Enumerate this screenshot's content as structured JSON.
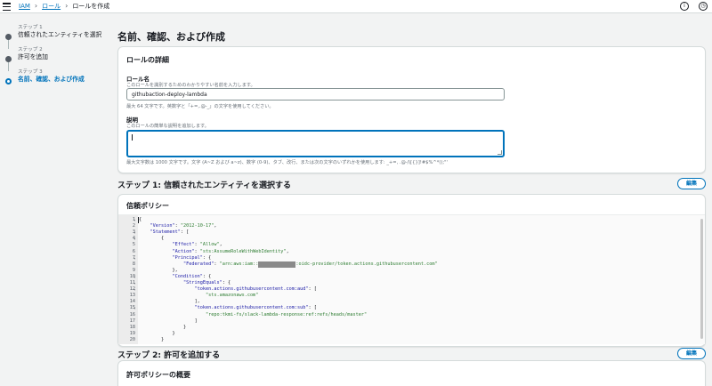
{
  "breadcrumb": {
    "iam": "IAM",
    "roles": "ロール",
    "current": "ロールを作成"
  },
  "steps": [
    {
      "num": "ステップ 1",
      "label": "信頼されたエンティティを選択"
    },
    {
      "num": "ステップ 2",
      "label": "許可を追加"
    },
    {
      "num": "ステップ 3",
      "label": "名前、確認、および作成"
    }
  ],
  "page_title": "名前、確認、および作成",
  "details": {
    "title": "ロールの詳細",
    "role_name_label": "ロール名",
    "role_name_desc": "このロールを識別するためのわかりやすい名前を入力します。",
    "role_name_value": "githubaction-deploy-lambda",
    "role_name_hint": "最大 64 文字です。英数字と「+=,.@-_」の文字を使用してください。",
    "desc_label": "説明",
    "desc_desc": "このロールの簡単な説明を追加します。",
    "desc_hint": "最大文字数は 1000 文字です。文字 (A~Z および a~z)、数字 (0-9)、タブ、改行、または次の文字のいずれかを使用します: _+=, .@-/\\[{}]!#$%^*();\"'"
  },
  "step1": {
    "header": "ステップ 1: 信頼されたエンティティを選択する",
    "edit_label": "編集",
    "policy_title": "信頼ポリシー"
  },
  "code_lines": [
    {
      "n": "1",
      "fold": true,
      "text": "{"
    },
    {
      "n": "2",
      "fold": false,
      "text": "    \"Version\": \"2012-10-17\","
    },
    {
      "n": "3",
      "fold": true,
      "text": "    \"Statement\": ["
    },
    {
      "n": "4",
      "fold": true,
      "text": "        {"
    },
    {
      "n": "5",
      "fold": false,
      "text": "            \"Effect\": \"Allow\","
    },
    {
      "n": "6",
      "fold": false,
      "text": "            \"Action\": \"sts:AssumeRoleWithWebIdentity\","
    },
    {
      "n": "7",
      "fold": true,
      "text": "            \"Principal\": {"
    },
    {
      "n": "8",
      "fold": false,
      "text": "                \"Federated\": \"arn:aws:iam::",
      "masked": true,
      "tail": ":oidc-provider/token.actions.githubusercontent.com\""
    },
    {
      "n": "9",
      "fold": false,
      "text": "            },"
    },
    {
      "n": "10",
      "fold": true,
      "text": "            \"Condition\": {"
    },
    {
      "n": "11",
      "fold": true,
      "text": "                \"StringEquals\": {"
    },
    {
      "n": "12",
      "fold": true,
      "text": "                    \"token.actions.githubusercontent.com:aud\": ["
    },
    {
      "n": "13",
      "fold": false,
      "text": "                        \"sts.amazonaws.com\""
    },
    {
      "n": "14",
      "fold": false,
      "text": "                    ],"
    },
    {
      "n": "15",
      "fold": true,
      "text": "                    \"token.actions.githubusercontent.com:sub\": ["
    },
    {
      "n": "16",
      "fold": false,
      "text": "                        \"repo:tkmi-fs/slack-lambda-response:ref:refs/heads/master\""
    },
    {
      "n": "17",
      "fold": false,
      "text": "                    ]"
    },
    {
      "n": "18",
      "fold": false,
      "text": "                }"
    },
    {
      "n": "19",
      "fold": false,
      "text": "            }"
    },
    {
      "n": "20",
      "fold": false,
      "text": "        }"
    }
  ],
  "step2": {
    "header": "ステップ 2: 許可を追加する",
    "edit_label": "編集",
    "summary_title": "許可ポリシーの概要"
  },
  "icons": {
    "info": "info-icon",
    "settings": "clock-settings-icon"
  },
  "colors": {
    "link": "#0073bb",
    "string": "#2e7d32",
    "key": "#1a1aa6"
  }
}
